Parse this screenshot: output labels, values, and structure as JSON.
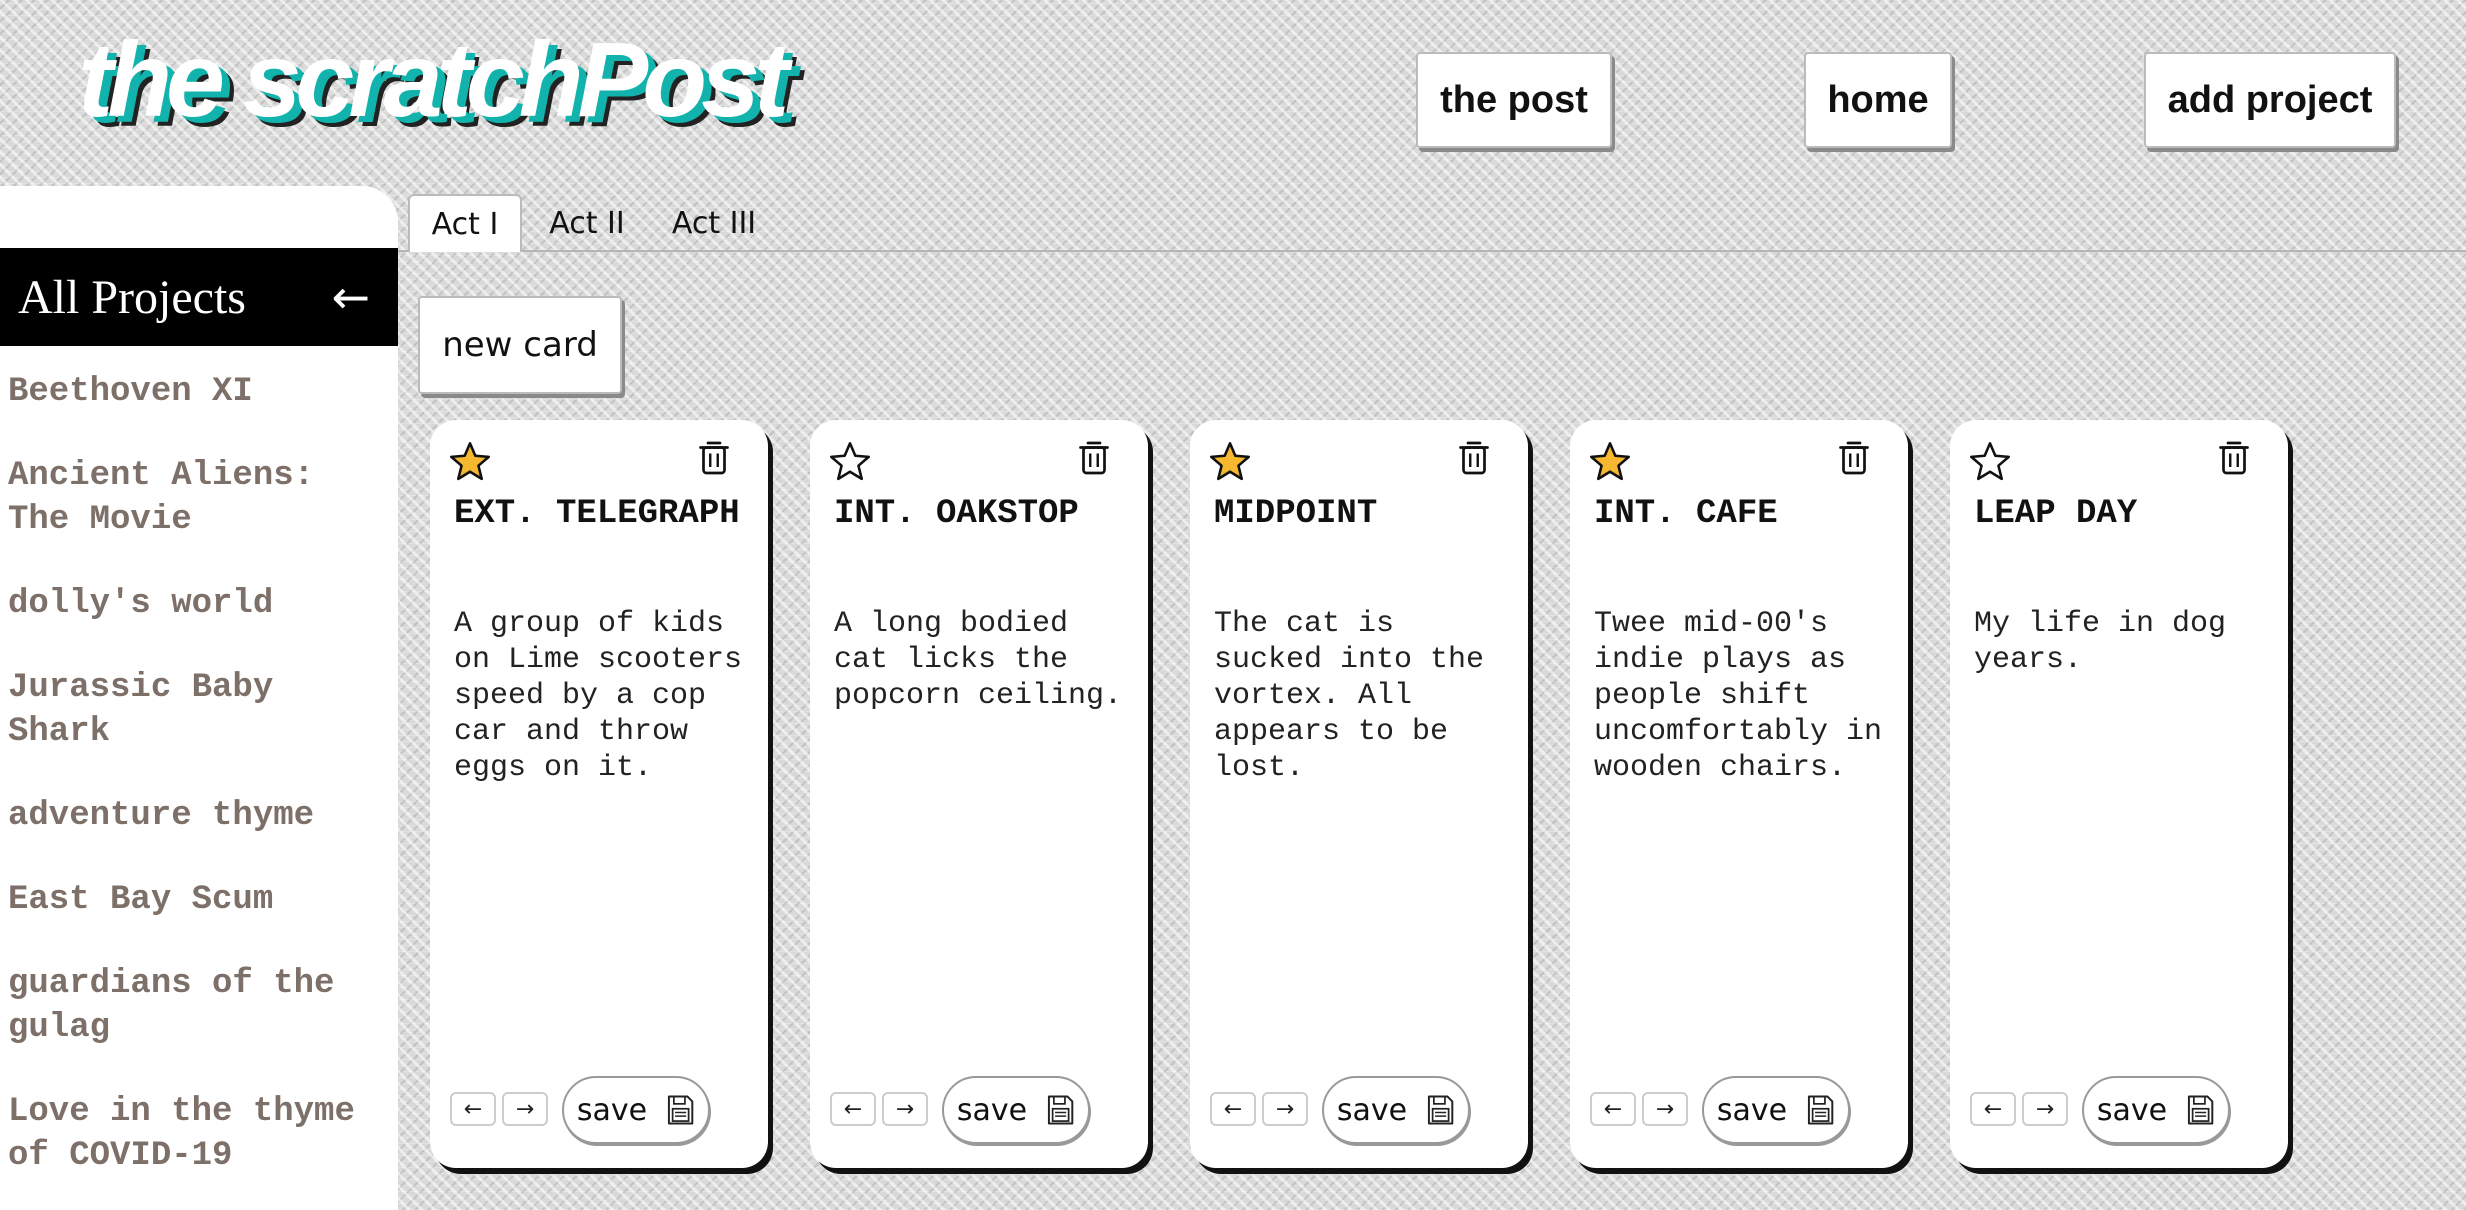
{
  "app": {
    "logo": "the scratchPost"
  },
  "nav": {
    "the_post": "the post",
    "home": "home",
    "add_project": "add project"
  },
  "sidebar": {
    "title": "All Projects",
    "collapse_icon": "left-arrow-icon",
    "collapse_glyph": "←",
    "projects": [
      "Beethoven XI",
      "Ancient Aliens: The Movie",
      "dolly's world",
      "Jurassic Baby Shark",
      "adventure thyme",
      "East Bay Scum",
      "guardians of the gulag",
      "Love in the thyme of COVID-19"
    ]
  },
  "tabs": [
    {
      "label": "Act I",
      "active": true
    },
    {
      "label": "Act II",
      "active": false
    },
    {
      "label": "Act III",
      "active": false
    }
  ],
  "new_card_label": "new card",
  "cards": [
    {
      "title": "EXT. TELEGRAPH",
      "body": "A group of kids on Lime scooters speed by a cop car and throw eggs on it.",
      "starred": true,
      "prev": "←",
      "next": "→",
      "save": "save"
    },
    {
      "title": "INT. OAKSTOP",
      "body": "A long bodied cat licks the popcorn ceiling.",
      "starred": false,
      "prev": "←",
      "next": "→",
      "save": "save"
    },
    {
      "title": "MIDPOINT",
      "body": "The cat is sucked into the vortex. All appears to be lost.",
      "starred": true,
      "prev": "←",
      "next": "→",
      "save": "save"
    },
    {
      "title": "INT. CAFE",
      "body": "Twee mid-00's indie plays as people shift uncomfortably in wooden chairs.",
      "starred": true,
      "prev": "←",
      "next": "→",
      "save": "save"
    },
    {
      "title": "LEAP DAY",
      "body": "My life in dog years.",
      "starred": false,
      "prev": "←",
      "next": "→",
      "save": "save"
    }
  ],
  "colors": {
    "star_filled": "#f5b82e",
    "logo_shadow_teal": "#12b3ac",
    "project_text": "#7d7068"
  },
  "icons": {
    "star": "star-icon",
    "trash": "trash-icon",
    "save": "floppy-disk-icon"
  }
}
